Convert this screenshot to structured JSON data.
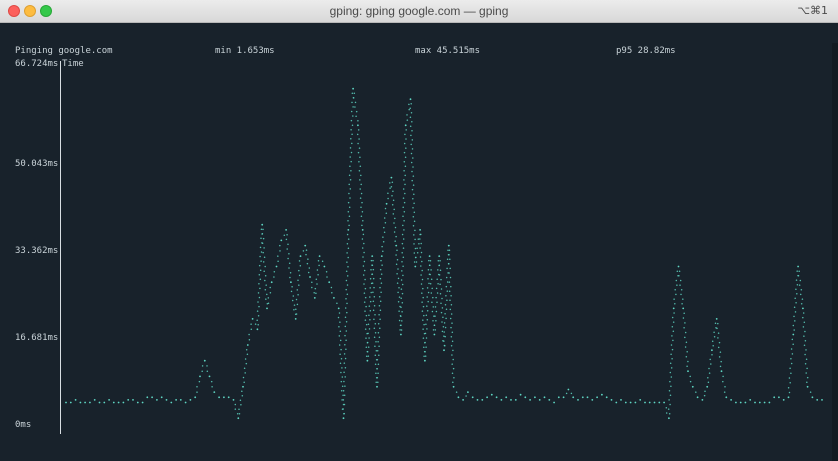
{
  "window": {
    "title": "gping: gping google.com — gping",
    "shortcut": "⌥⌘1"
  },
  "stats": {
    "host": "Pinging google.com",
    "min": "min 1.653ms",
    "max": "max 45.515ms",
    "p95": "p95 28.82ms"
  },
  "legend": "Time",
  "colors": {
    "background": "#18222b",
    "line": "#5fd7c4",
    "text": "#c9d3d8"
  },
  "chart_data": {
    "type": "line",
    "ylim": [
      0,
      66.724
    ],
    "y_ticks": [
      "66.724ms",
      "50.043ms",
      "33.362ms",
      "16.681ms",
      "0ms"
    ],
    "y_tick_values": [
      66.724,
      50.043,
      33.362,
      16.681,
      0
    ],
    "series": [
      {
        "values": [
          2,
          2,
          2.5,
          2,
          2,
          2,
          2.5,
          2,
          2,
          2.5,
          2,
          2,
          2,
          2.5,
          2.5,
          2,
          2,
          3,
          3,
          2.5,
          3,
          2.5,
          2,
          2.5,
          2.5,
          2,
          2.5,
          3,
          7,
          10,
          7,
          4,
          3,
          3,
          3,
          2.5,
          -1,
          5,
          13,
          18,
          16,
          36,
          20,
          25,
          28,
          33,
          35,
          25,
          18,
          30,
          32,
          26,
          22,
          30,
          28,
          25,
          22,
          20,
          -1,
          35,
          62,
          55,
          35,
          10,
          30,
          5,
          30,
          40,
          45,
          32,
          15,
          55,
          60,
          28,
          35,
          10,
          30,
          15,
          30,
          12,
          32,
          5,
          3,
          2.5,
          4,
          3,
          2.5,
          2.5,
          3,
          3.5,
          3,
          2.5,
          3,
          2.5,
          2.5,
          3.5,
          3,
          2.5,
          3,
          2.5,
          3,
          2.5,
          2,
          3,
          3,
          4.5,
          3,
          2.5,
          3,
          3,
          2.5,
          3,
          3.5,
          3,
          2.5,
          2,
          2.5,
          2,
          2,
          2,
          2.5,
          2,
          2,
          2,
          2,
          2,
          -1,
          20,
          28,
          20,
          8,
          5,
          3,
          2.5,
          5,
          12,
          18,
          8,
          3,
          2.5,
          2,
          2,
          2,
          2.5,
          2,
          2,
          2,
          2,
          3,
          3,
          2.5,
          3,
          15,
          28,
          20,
          5,
          3,
          2.5,
          2.5
        ]
      }
    ]
  }
}
